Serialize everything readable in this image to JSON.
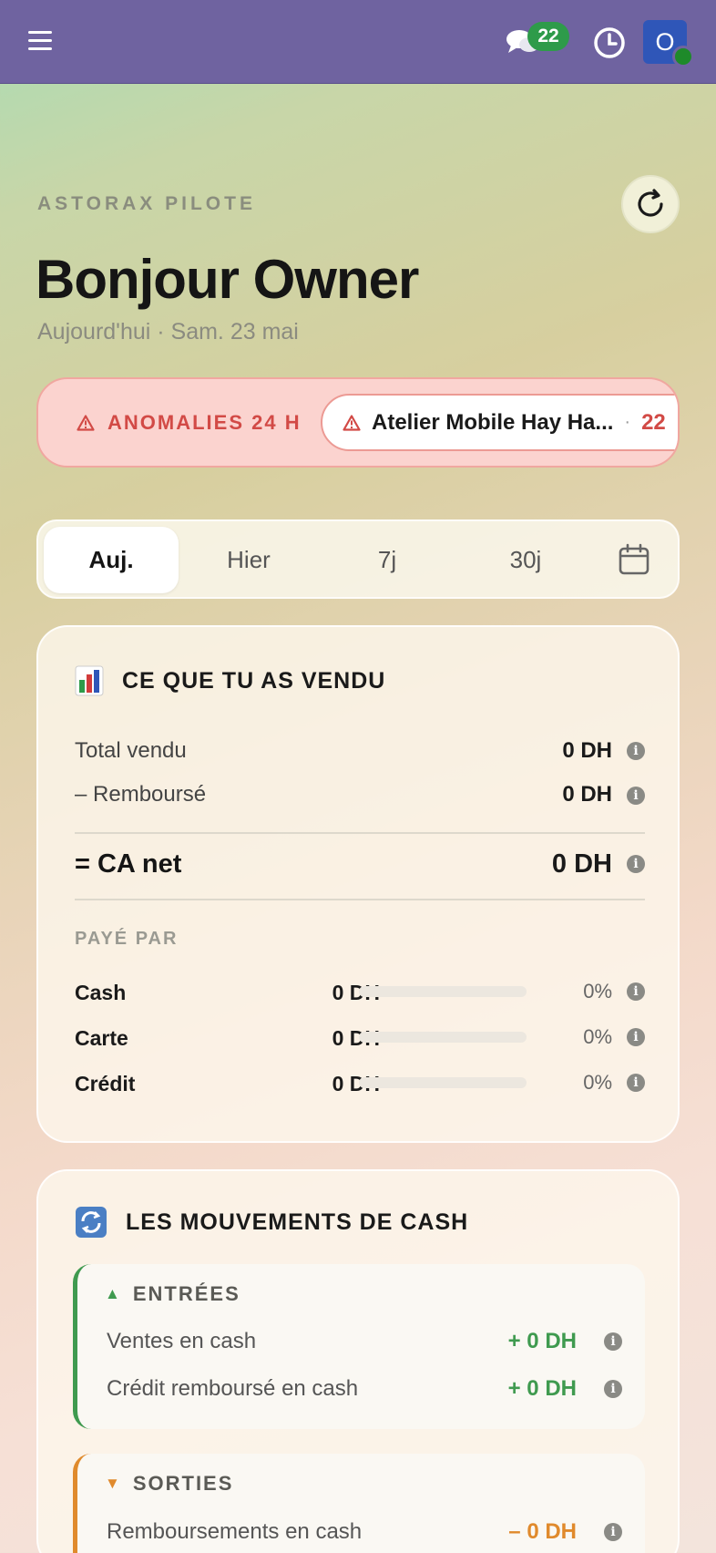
{
  "topbar": {
    "menu_icon": "hamburger-menu-icon",
    "chat_badge": "22",
    "history_icon": "clock-history-icon",
    "avatar_initial": "O"
  },
  "header": {
    "brand": "ASTORAX PILOTE",
    "greeting": "Bonjour Owner",
    "date_line": "Aujourd'hui · Sam. 23 mai"
  },
  "anomalies": {
    "label": "ANOMALIES 24 H",
    "chip_text": "Atelier Mobile Hay Ha...",
    "chip_separator": "·",
    "chip_count": "22"
  },
  "period_tabs": [
    {
      "label": "Auj.",
      "active": true
    },
    {
      "label": "Hier",
      "active": false
    },
    {
      "label": "7j",
      "active": false
    },
    {
      "label": "30j",
      "active": false
    }
  ],
  "sales": {
    "title": "CE QUE TU AS VENDU",
    "rows": [
      {
        "label": "Total vendu",
        "value": "0 DH"
      },
      {
        "label": "– Remboursé",
        "value": "0 DH"
      }
    ],
    "net": {
      "label": "= CA net",
      "value": "0 DH"
    },
    "paid_by_label": "PAYÉ PAR",
    "payments": [
      {
        "label": "Cash",
        "amount": "0 DH",
        "percent": "0%",
        "fraction": 0
      },
      {
        "label": "Carte",
        "amount": "0 DH",
        "percent": "0%",
        "fraction": 0
      },
      {
        "label": "Crédit",
        "amount": "0 DH",
        "percent": "0%",
        "fraction": 0
      }
    ]
  },
  "cash": {
    "title": "LES MOUVEMENTS DE CASH",
    "entries": {
      "title": "ENTRÉES",
      "rows": [
        {
          "label": "Ventes en cash",
          "value": "+ 0 DH"
        },
        {
          "label": "Crédit remboursé en cash",
          "value": "+ 0 DH"
        }
      ]
    },
    "exits": {
      "title": "SORTIES",
      "rows": [
        {
          "label": "Remboursements en cash",
          "value": "– 0 DH"
        }
      ]
    }
  },
  "colors": {
    "topbar": "#6f63a0",
    "badge_green": "#2e9b4a",
    "anomaly_red": "#d24a46",
    "positive_green": "#3f9a4f",
    "negative_orange": "#e08a2c"
  }
}
